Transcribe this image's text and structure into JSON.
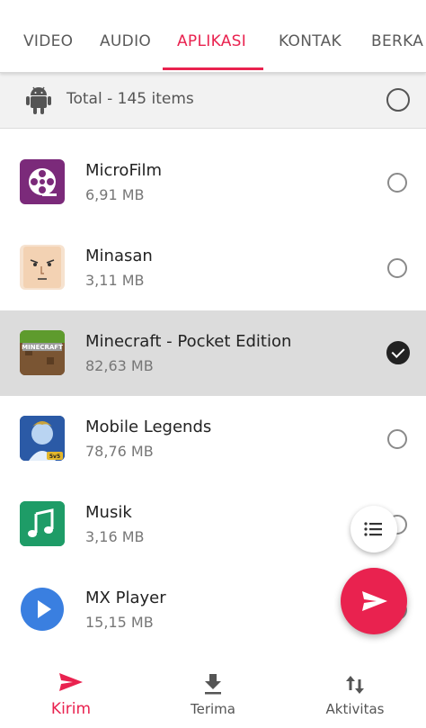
{
  "tabs": {
    "video": "VIDEO",
    "audio": "AUDIO",
    "aplikasi": "APLIKASI",
    "kontak": "KONTAK",
    "berkas": "BERKA"
  },
  "total": {
    "text": "Total - 145 items",
    "icon": "android-icon"
  },
  "apps": [
    {
      "name": "MicroFilm",
      "size": "6,91 MB",
      "selected": false
    },
    {
      "name": "Minasan",
      "size": "3,11 MB",
      "selected": false
    },
    {
      "name": "Minecraft - Pocket Edition",
      "size": "82,63 MB",
      "selected": true
    },
    {
      "name": "Mobile Legends",
      "size": "78,76 MB",
      "selected": false
    },
    {
      "name": "Musik",
      "size": "3,16 MB",
      "selected": false
    },
    {
      "name": "MX Player",
      "size": "15,15 MB",
      "selected": false
    }
  ],
  "fab": {
    "small_icon": "list-icon",
    "big_icon": "send-icon"
  },
  "bottom_nav": {
    "kirim": "Kirim",
    "terima": "Terima",
    "aktivitas": "Aktivitas"
  },
  "colors": {
    "accent": "#e9224f",
    "selected_row": "#dcdcdc",
    "header_row": "#f2f2f2"
  }
}
